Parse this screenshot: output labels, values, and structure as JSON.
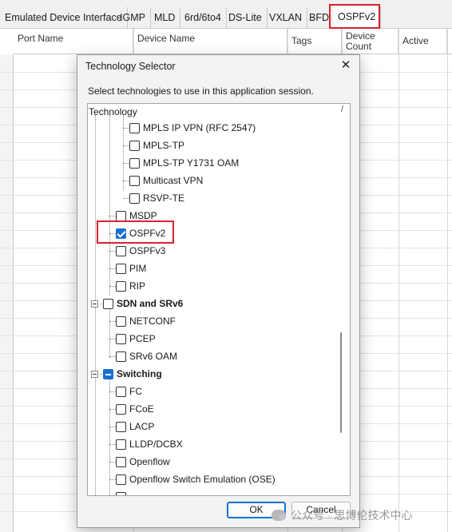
{
  "tabs": [
    {
      "label": "Emulated Device Interface"
    },
    {
      "label": "IGMP"
    },
    {
      "label": "MLD"
    },
    {
      "label": "6rd/6to4"
    },
    {
      "label": "DS-Lite"
    },
    {
      "label": "VXLAN"
    },
    {
      "label": "BFD"
    },
    {
      "label": "OSPFv2"
    }
  ],
  "grid": {
    "columns": [
      "Port Name",
      "Device Name",
      "Tags",
      "Device Count",
      "Active"
    ]
  },
  "dialog": {
    "title": "Technology Selector",
    "close_icon": "close-icon",
    "instruction": "Select technologies to use in this application session.",
    "tree_header": "Technology",
    "tree_header_mark": "/",
    "items": [
      {
        "label": "MPLS IP VPN (RFC 2547)",
        "checked": false
      },
      {
        "label": "MPLS-TP",
        "checked": false
      },
      {
        "label": "MPLS-TP Y1731 OAM",
        "checked": false
      },
      {
        "label": "Multicast VPN",
        "checked": false
      },
      {
        "label": "RSVP-TE",
        "checked": false
      },
      {
        "label": "MSDP",
        "checked": false
      },
      {
        "label": "OSPFv2",
        "checked": true
      },
      {
        "label": "OSPFv3",
        "checked": false
      },
      {
        "label": "PIM",
        "checked": false
      },
      {
        "label": "RIP",
        "checked": false
      },
      {
        "label": "SDN and SRv6",
        "checked": false,
        "group": true
      },
      {
        "label": "NETCONF",
        "checked": false
      },
      {
        "label": "PCEP",
        "checked": false
      },
      {
        "label": "SRv6 OAM",
        "checked": false
      },
      {
        "label": "Switching",
        "checked": "partial",
        "group": true
      },
      {
        "label": "FC",
        "checked": false
      },
      {
        "label": "FCoE",
        "checked": false
      },
      {
        "label": "LACP",
        "checked": false
      },
      {
        "label": "LLDP/DCBX",
        "checked": false
      },
      {
        "label": "Openflow",
        "checked": false
      },
      {
        "label": "Openflow Switch Emulation (OSE)",
        "checked": false
      }
    ],
    "ok_label": "OK",
    "cancel_label": "Cancel"
  },
  "watermark": {
    "text": "公众号 · 思博伦技术中心"
  },
  "colors": {
    "highlight": "#d9232d",
    "accent": "#1a6fd3"
  }
}
